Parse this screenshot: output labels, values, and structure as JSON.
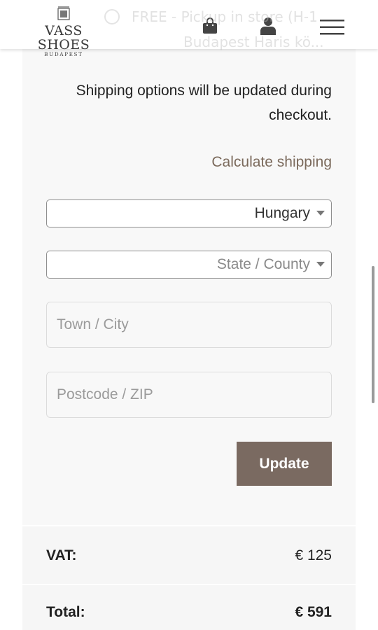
{
  "header": {
    "brand": "VASS SHOES",
    "city": "BUDAPEST",
    "icons": [
      "shopping-bag-icon",
      "user-icon",
      "menu-icon"
    ]
  },
  "background_shipping_option": {
    "line1": "FREE - Pickup in store (H-1",
    "line2": "Budapest Haris kö..."
  },
  "shipping": {
    "note": "Shipping options will be updated during checkout.",
    "calculate_link": "Calculate shipping",
    "country": "Hungary",
    "state_placeholder": "State / County",
    "town_placeholder": "Town / City",
    "postcode_placeholder": "Postcode / ZIP",
    "update_label": "Update"
  },
  "totals": {
    "vat_label": "VAT:",
    "vat_value": "€ 125",
    "total_label": "Total:",
    "total_value": "€ 591"
  },
  "colors": {
    "accent_brown": "#7a6a61",
    "link_brown": "#7b6a5c",
    "panel_bg": "#f8f8f8"
  }
}
